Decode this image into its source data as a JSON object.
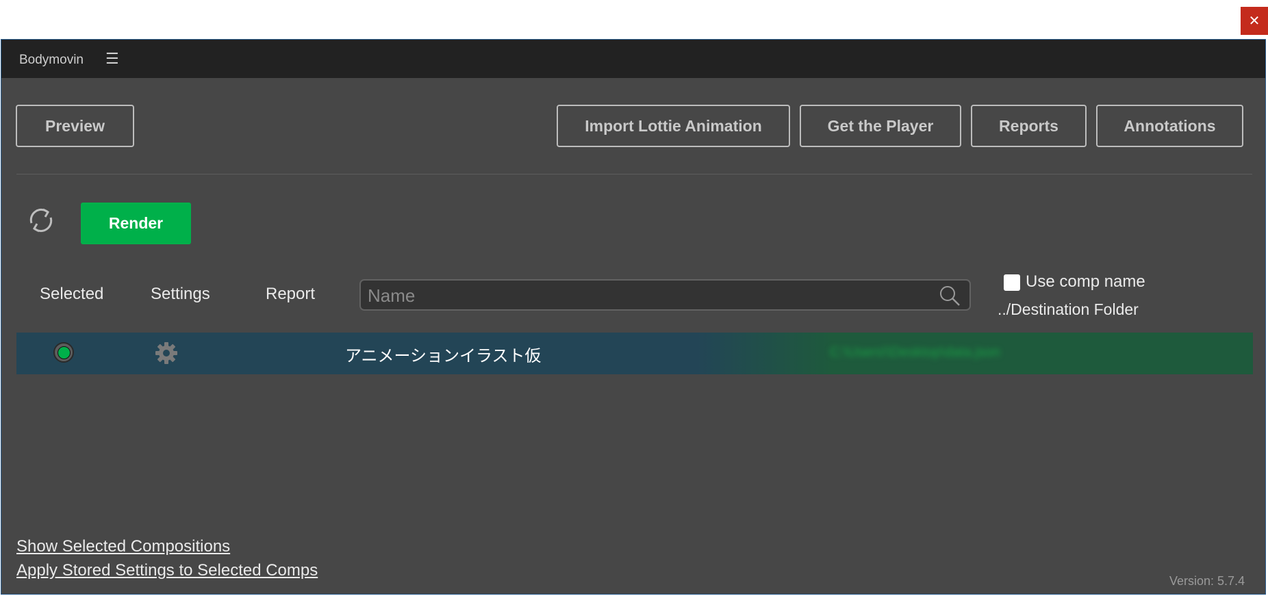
{
  "window": {
    "close_glyph": "✕"
  },
  "panel": {
    "title": "Bodymovin",
    "menu_glyph": "☰"
  },
  "toolbar": {
    "preview": "Preview",
    "import_lottie": "Import Lottie Animation",
    "get_player": "Get the Player",
    "reports": "Reports",
    "annotations": "Annotations"
  },
  "actions": {
    "render": "Render",
    "refresh_icon": "refresh-icon"
  },
  "columns": {
    "selected": "Selected",
    "settings": "Settings",
    "report": "Report"
  },
  "search": {
    "placeholder": "Name",
    "value": ""
  },
  "options": {
    "use_comp_name": "Use comp name",
    "use_comp_name_checked": false,
    "destination_folder": "../Destination Folder"
  },
  "compositions": [
    {
      "name": "アニメーションイラスト仮",
      "selected": true,
      "destination": "C:\\Users\\\\Desktop\\data.json"
    }
  ],
  "footer": {
    "show_selected": "Show Selected Compositions",
    "apply_stored": "Apply Stored Settings to Selected Comps",
    "version": "Version: 5.7.4"
  },
  "colors": {
    "accent_green": "#00b04a",
    "panel_bg": "#474747",
    "header_bg": "#222222",
    "row_selected": "#234556"
  }
}
